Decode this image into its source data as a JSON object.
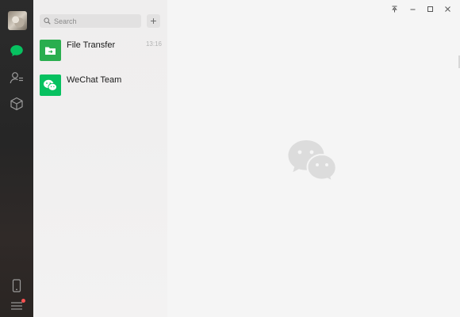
{
  "search": {
    "placeholder": "Search"
  },
  "add_button": {
    "label": "+"
  },
  "chats": [
    {
      "name": "File Transfer",
      "time": "13:16",
      "avatar_color": "#2aae4f",
      "icon": "folder-transfer-icon"
    },
    {
      "name": "WeChat Team",
      "time": "",
      "avatar_color": "#07c160",
      "icon": "wechat-logo-icon"
    }
  ],
  "sidebar": {
    "items": [
      {
        "name": "chats",
        "icon": "chat-bubble-icon",
        "active": true
      },
      {
        "name": "contacts",
        "icon": "contacts-icon",
        "active": false
      },
      {
        "name": "favorites",
        "icon": "cube-icon",
        "active": false
      },
      {
        "name": "phone",
        "icon": "phone-icon",
        "active": false
      },
      {
        "name": "menu",
        "icon": "menu-icon",
        "badge": true
      }
    ]
  },
  "window_controls": [
    "pin-icon",
    "minimize-icon",
    "maximize-icon",
    "close-icon"
  ],
  "colors": {
    "rail": "#2b2b2b",
    "accent_green": "#07c160",
    "list_bg": "#efeeee",
    "main_bg": "#f5f5f5",
    "badge_red": "#fa5151"
  }
}
